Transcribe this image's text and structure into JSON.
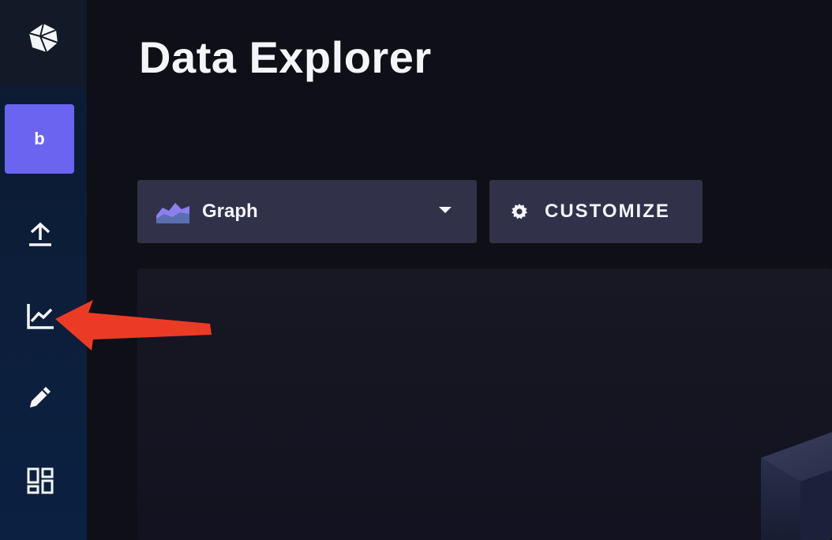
{
  "sidebar": {
    "logo": "influx-cube-logo-icon",
    "org_initial": "b",
    "nav_items": [
      {
        "icon": "upload-icon",
        "name": "load-data"
      },
      {
        "icon": "line-chart-icon",
        "name": "data-explorer"
      },
      {
        "icon": "pencil-icon",
        "name": "notebooks"
      },
      {
        "icon": "dashboard-grid-icon",
        "name": "dashboards"
      }
    ]
  },
  "main": {
    "title": "Data Explorer",
    "view_type": {
      "selected": "Graph",
      "icon": "graph-area-icon"
    },
    "customize_label": "CUSTOMIZE"
  },
  "colors": {
    "org_button": "#6b64f0",
    "control_bg": "#31314a",
    "annotation_arrow": "#ec3b25"
  }
}
